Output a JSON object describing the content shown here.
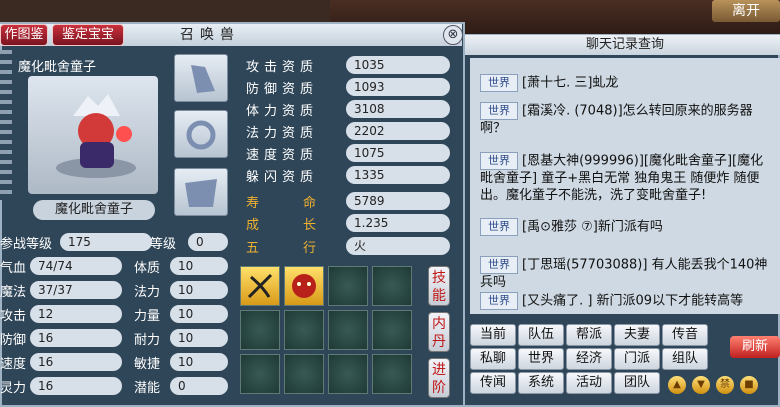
{
  "top": {
    "exit_label": "离开"
  },
  "summon": {
    "tab1": "作图鉴",
    "tab2": "鉴定宝宝",
    "title": "召唤兽",
    "close": "⊗",
    "pet_name": "魔化毗舍童子",
    "attributes": [
      {
        "label": "攻击资质",
        "value": "1035"
      },
      {
        "label": "防御资质",
        "value": "1093"
      },
      {
        "label": "体力资质",
        "value": "3108"
      },
      {
        "label": "法力资质",
        "value": "2202"
      },
      {
        "label": "速度资质",
        "value": "1075"
      },
      {
        "label": "躲闪资质",
        "value": "1335"
      },
      {
        "label": "寿命",
        "value": "5789"
      },
      {
        "label": "成长",
        "value": "1.235"
      },
      {
        "label": "五行",
        "value": "火"
      }
    ],
    "stats_left": [
      {
        "label": "参战等级",
        "value": "175"
      },
      {
        "label": "气血",
        "value": "74/74"
      },
      {
        "label": "魔法",
        "value": "37/37"
      },
      {
        "label": "攻击",
        "value": "12"
      },
      {
        "label": "防御",
        "value": "16"
      },
      {
        "label": "速度",
        "value": "16"
      },
      {
        "label": "灵力",
        "value": "16"
      }
    ],
    "stats_right": [
      {
        "label": "等级",
        "value": "0"
      },
      {
        "label": "体质",
        "value": "10"
      },
      {
        "label": "法力",
        "value": "10"
      },
      {
        "label": "力量",
        "value": "10"
      },
      {
        "label": "耐力",
        "value": "10"
      },
      {
        "label": "敏捷",
        "value": "10"
      },
      {
        "label": "潜能",
        "value": "0"
      }
    ],
    "side_tabs": [
      "技能",
      "内丹",
      "进阶"
    ]
  },
  "chat": {
    "title": "聊天记录查询",
    "channel_tag": "世界",
    "messages": [
      {
        "text": "[萧十七. 三]虬龙"
      },
      {
        "text": "[霜溪冷. (7048)]怎么转回原来的服务器啊？"
      },
      {
        "text": "[恩基大神(999996)][魔化毗舍童子][魔化毗舍童子] 童子+黑白无常 独角鬼王 随便炸 随便出。魔化童子不能洗，洗了变毗舍童子!"
      },
      {
        "text": "[禹⊙雅莎 ⑦]新门派有吗"
      },
      {
        "text": "[丁思瑶(57703088)] 有人能丢我个140神兵吗"
      },
      {
        "text": "[又头痛了. ] 新门派09以下才能转高等"
      }
    ],
    "buttons_row1": [
      "当前",
      "队伍",
      "帮派",
      "夫妻",
      "传音"
    ],
    "buttons_row2": [
      "私聊",
      "世界",
      "经济",
      "门派",
      "组队"
    ],
    "buttons_row3": [
      "传闻",
      "系统",
      "活动",
      "团队"
    ],
    "refresh": "刷新",
    "mini_icons": [
      "▲",
      "▼",
      "禁",
      "■"
    ]
  }
}
